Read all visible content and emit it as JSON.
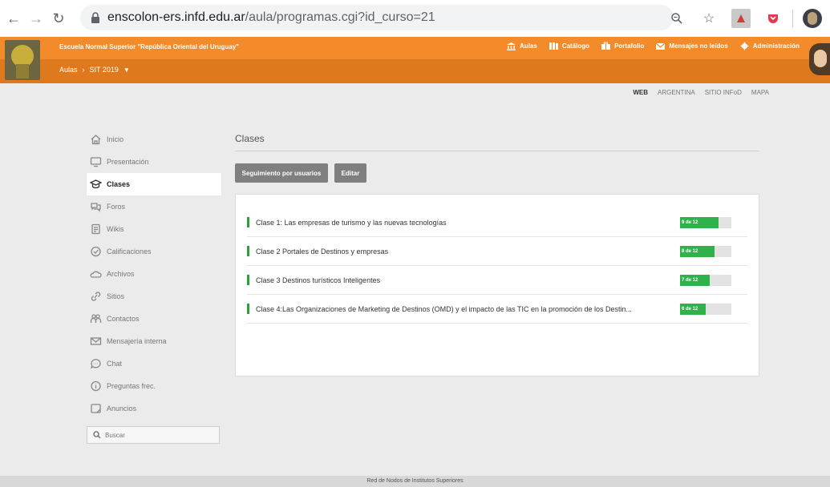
{
  "browser": {
    "url_host": "enscolon-ers.infd.edu.ar",
    "url_path": "/aula/programas.cgi?id_curso=21"
  },
  "header": {
    "school_name": "Escuela Normal Superior \"República Oriental del Uruguay\"",
    "breadcrumb_root": "Aulas",
    "breadcrumb_separator": "›",
    "breadcrumb_current": "SIT 2019",
    "nav": [
      {
        "label": "Aulas",
        "icon": "columns-icon"
      },
      {
        "label": "Catálogo",
        "icon": "books-icon"
      },
      {
        "label": "Portafolio",
        "icon": "briefcase-icon"
      },
      {
        "label": "Mensajes no leídos",
        "icon": "mail-icon"
      },
      {
        "label": "Administración",
        "icon": "gear-icon"
      }
    ],
    "accent_color": "#f38b2a"
  },
  "toplinks": [
    "WEB",
    "ARGENTINA",
    "SITIO INFoD",
    "MAPA"
  ],
  "sidebar": {
    "items": [
      {
        "label": "Inicio",
        "icon": "home-icon"
      },
      {
        "label": "Presentación",
        "icon": "monitor-icon"
      },
      {
        "label": "Clases",
        "icon": "graduation-cap-icon"
      },
      {
        "label": "Foros",
        "icon": "chat-bubbles-icon"
      },
      {
        "label": "Wikis",
        "icon": "document-icon"
      },
      {
        "label": "Calificaciones",
        "icon": "check-circle-icon"
      },
      {
        "label": "Archivos",
        "icon": "cloud-icon"
      },
      {
        "label": "Sitios",
        "icon": "link-icon"
      },
      {
        "label": "Contactos",
        "icon": "contacts-icon"
      },
      {
        "label": "Mensajería interna",
        "icon": "envelope-icon"
      },
      {
        "label": "Chat",
        "icon": "chat-icon"
      },
      {
        "label": "Preguntas frec.",
        "icon": "info-icon"
      },
      {
        "label": "Anuncios",
        "icon": "announcement-icon"
      }
    ],
    "active_index": 2,
    "search_placeholder": "Buscar"
  },
  "main": {
    "title": "Clases",
    "btn_seguimiento": "Seguimiento por usuarios",
    "btn_editar": "Editar",
    "classes": [
      {
        "label": "Clase 1: Las empresas de turismo y las nuevas tecnologías",
        "progress_text": "9 de 12",
        "progress": 0.75
      },
      {
        "label": "Clase 2 Portales de Destinos y empresas",
        "progress_text": "8 de 12",
        "progress": 0.6667
      },
      {
        "label": "Clase 3 Destinos turísticos Inteligentes",
        "progress_text": "7 de 12",
        "progress": 0.5833
      },
      {
        "label": "Clase 4:Las Organizaciones de Marketing de Destinos (OMD) y el impacto de las TIC en la promoción de los Destin...",
        "progress_text": "6 de 12",
        "progress": 0.5
      }
    ],
    "progress_color": "#2fb14b"
  },
  "footer": {
    "text": "Red de Nodos de Institutos Superiores"
  }
}
